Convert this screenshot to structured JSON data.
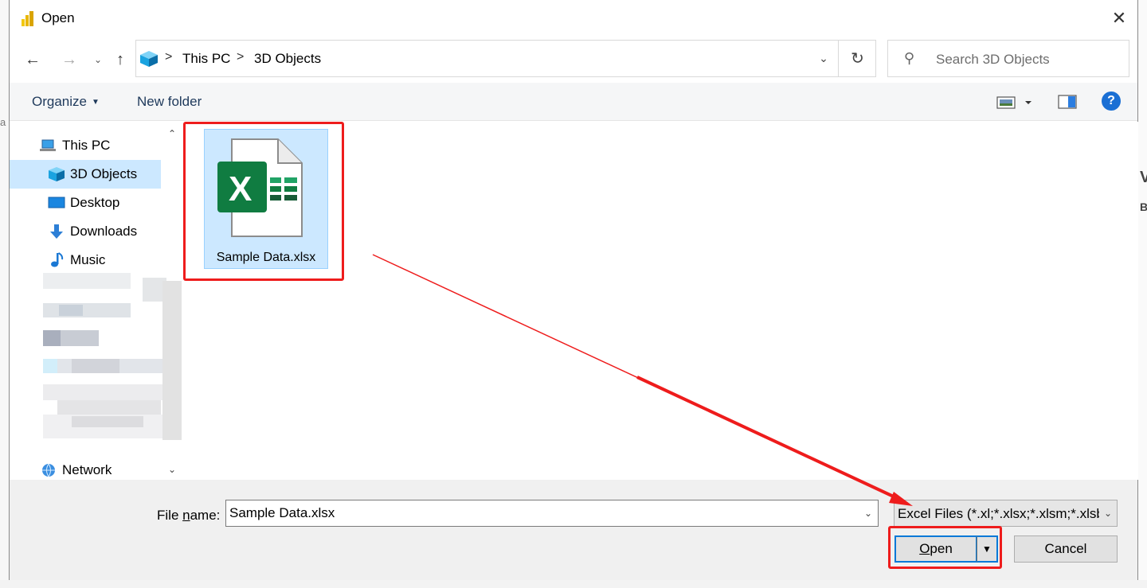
{
  "window": {
    "title": "Open",
    "close_glyph": "✕"
  },
  "nav": {
    "back_glyph": "←",
    "forward_glyph": "→",
    "recent_glyph": "⌄",
    "up_glyph": "↑"
  },
  "address": {
    "breadcrumb": [
      "This PC",
      "3D Objects"
    ],
    "separator": ">",
    "dropdown_glyph": "⌄",
    "refresh_glyph": "↻"
  },
  "search": {
    "placeholder": "Search 3D Objects",
    "icon_glyph": "⚲"
  },
  "toolbar": {
    "organize_label": "Organize",
    "organize_caret": "▼",
    "new_folder_label": "New folder",
    "help_glyph": "?"
  },
  "sidebar": {
    "items": [
      {
        "label": "This PC",
        "icon": "computer-icon"
      },
      {
        "label": "3D Objects",
        "icon": "cube-icon",
        "selected": true
      },
      {
        "label": "Desktop",
        "icon": "desktop-icon"
      },
      {
        "label": "Downloads",
        "icon": "download-arrow-icon"
      },
      {
        "label": "Music",
        "icon": "music-note-icon"
      },
      {
        "label": "Network",
        "icon": "network-globe-icon"
      }
    ],
    "scroll_up_glyph": "⌃",
    "scroll_down_glyph": "⌄"
  },
  "files": [
    {
      "name": "Sample Data.xlsx",
      "type": "excel",
      "selected": true,
      "icon_letter": "X"
    }
  ],
  "footer": {
    "file_name_label_pre": "File ",
    "file_name_label_underlined": "n",
    "file_name_label_post": "ame:",
    "file_name_value": "Sample Data.xlsx",
    "filter_value": "Excel Files (*.xl;*.xlsx;*.xlsm;*.xlsb",
    "dropdown_glyph": "⌄",
    "open_underlined": "O",
    "open_rest": "pen",
    "open_split_glyph": "▼",
    "cancel_label": "Cancel"
  },
  "background": {
    "left_glyph": "a",
    "right_glyphs": [
      "V",
      "B"
    ]
  },
  "colors": {
    "accent": "#0078d7",
    "selection": "#cce8ff",
    "annotation_red": "#ee1c1c",
    "excel_green": "#107c41"
  }
}
